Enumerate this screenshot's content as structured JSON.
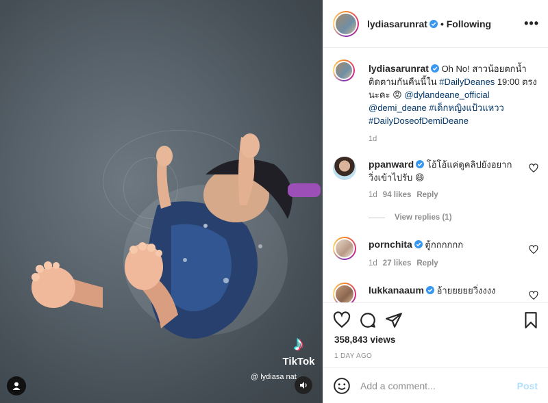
{
  "media": {
    "tiktok_word": "TikTok",
    "tiktok_handle": "@ lydiasa  nat"
  },
  "header": {
    "username": "lydiasarunrat",
    "follow_label": "• Following",
    "more_icon": "more-horizontal-icon"
  },
  "caption": {
    "username": "lydiasarunrat",
    "text_part1": "Oh No! สาวน้อยตกน้ำ ติดตามกันคืนนี้ใน ",
    "tag1": "#DailyDeanes",
    "text_part2": " 19:00 ตรงนะคะ 😡 ",
    "mention1": "@dylandeane_official",
    "mention2": "@demi_deane",
    "tag2": "#เด็กหญิงแป้วแหวว",
    "tag3": "#DailyDoseofDemiDeane",
    "time": "1d"
  },
  "comments": [
    {
      "username": "ppanward",
      "text": "โอ้โอ้แค่ดูคลิปยังอยากวิ่งเข้าไปรับ 😄",
      "time": "1d",
      "likes": "94 likes",
      "reply": "Reply",
      "view_replies": "View replies (1)"
    },
    {
      "username": "pornchita",
      "text": "ตู้กกกกกก",
      "time": "1d",
      "likes": "27 likes",
      "reply": "Reply"
    },
    {
      "username": "lukkanaaum",
      "text": "อ้ายยยยยวิ่งงงง"
    }
  ],
  "actions": {
    "views": "358,843 views",
    "date": "1 DAY AGO"
  },
  "add_comment": {
    "placeholder": "Add a comment...",
    "post_label": "Post"
  },
  "colors": {
    "link": "#00376b",
    "verified": "#3897f0",
    "post_disabled": "#b2dffc"
  }
}
